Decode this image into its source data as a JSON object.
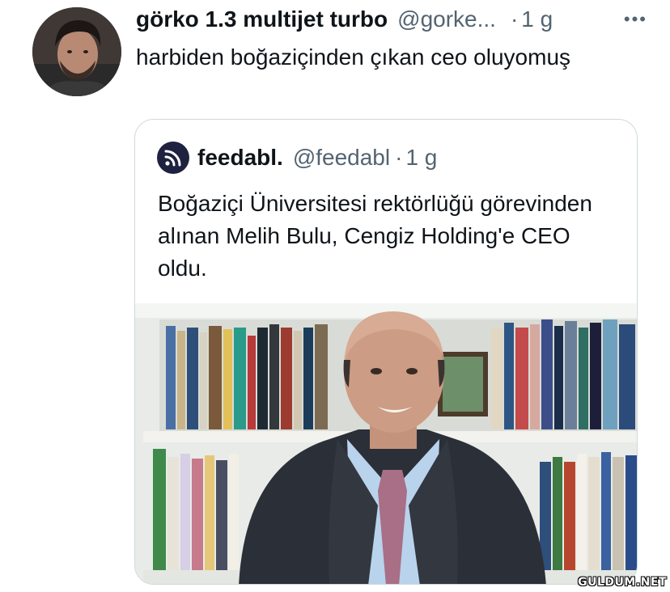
{
  "tweet": {
    "author_name": "görko 1.3 multijet turbo",
    "handle": "@gorke...",
    "separator": "·",
    "time": "1 g",
    "more_icon": "more-icon",
    "text": "harbiden boğaziçinden çıkan ceo oluyomuş"
  },
  "quote": {
    "author_name": "feedabl.",
    "handle": "@feedabl",
    "separator": "·",
    "time": "1 g",
    "text": "Boğaziçi Üniversitesi rektörlüğü görevinden alınan Melih Bulu, Cengiz Holding'e CEO oldu."
  },
  "watermark": "GULDUM.NET"
}
